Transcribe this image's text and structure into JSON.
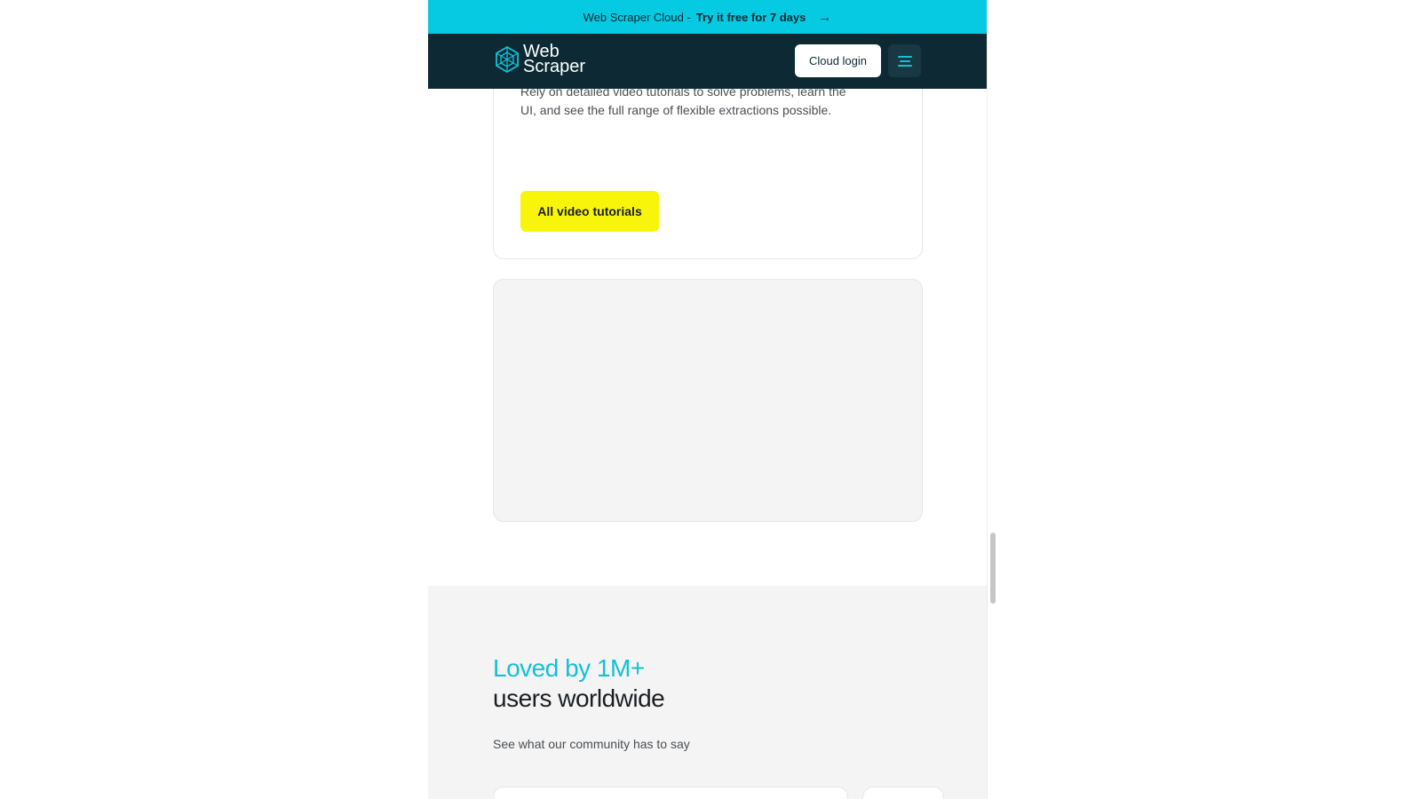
{
  "promo_bar": {
    "prefix": "Web Scraper Cloud -",
    "cta": "Try it free for 7 days",
    "arrow": "→",
    "background": "#06c9e2"
  },
  "navbar": {
    "logo": {
      "line1": "Web",
      "line2": "Scraper"
    },
    "login_label": "Cloud login",
    "menu_icon": "hamburger-icon",
    "background": "#0d2a34"
  },
  "tutorial_card": {
    "text": "Rely on detailed video tutorials to solve problems, learn the UI, and see the full range of flexible extractions possible.",
    "button_label": "All video tutorials",
    "button_color": "#f8f50b"
  },
  "testimonials": {
    "title_accent": "Loved by 1M+",
    "title_main": "users worldwide",
    "subtitle": "See what our community has to say",
    "accent_color": "#14c0d8"
  }
}
